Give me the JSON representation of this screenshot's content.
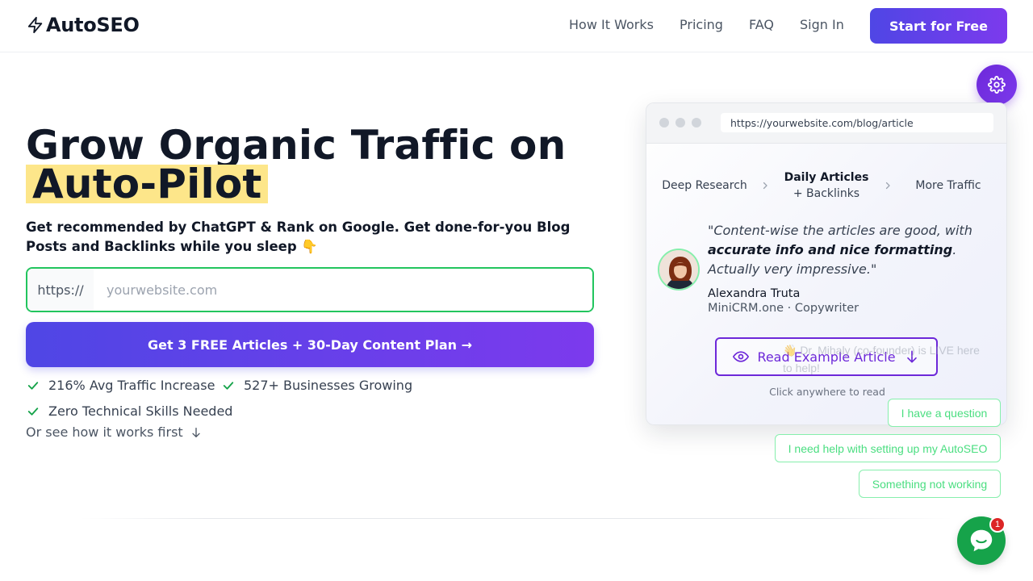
{
  "nav": {
    "brand": "AutoSEO",
    "links": [
      "How It Works",
      "Pricing",
      "FAQ",
      "Sign In"
    ],
    "cta": "Start for Free"
  },
  "hero": {
    "title_line1": "Grow Organic Traffic on",
    "title_highlight": "Auto-Pilot",
    "subtitle": "Get recommended by ChatGPT & Rank on Google. Get done-for-you Blog Posts and Backlinks while you sleep 👇",
    "url_prefix": "https://",
    "url_placeholder": "yourwebsite.com",
    "cta": "Get 3 FREE Articles + 30-Day Content Plan →",
    "features": [
      "216% Avg Traffic Increase",
      "527+ Businesses Growing",
      "Zero Technical Skills Needed"
    ],
    "see_how": "Or see how it works first"
  },
  "preview": {
    "url": "https://yourwebsite.com/blog/article",
    "steps": [
      {
        "main": "Deep Research",
        "sub": ""
      },
      {
        "main": "Daily Articles",
        "sub": "+ Backlinks"
      },
      {
        "main": "More Traffic",
        "sub": ""
      }
    ],
    "quote_pre": "\"Content-wise the articles are good, with ",
    "quote_bold": "accurate info and nice formatting",
    "quote_post": ". Actually very impressive.\"",
    "author": "Alexandra Truta",
    "author_role": "MiniCRM.one · Copywriter",
    "read_button": "Read Example Article",
    "hint": "Click anywhere to read"
  },
  "chat": {
    "ghost_message": "👋 Dr. Mihaly (co-founder) is LIVE here to help!",
    "quick_replies": [
      "I have a question",
      "I need help with setting up my AutoSEO",
      "Something not working"
    ],
    "badge": "1"
  },
  "colors": {
    "brand_gradient_start": "#4f46e5",
    "brand_gradient_end": "#7c3aed",
    "highlight": "#fde68a",
    "success": "#22c55e",
    "chat": "#16a34a"
  }
}
